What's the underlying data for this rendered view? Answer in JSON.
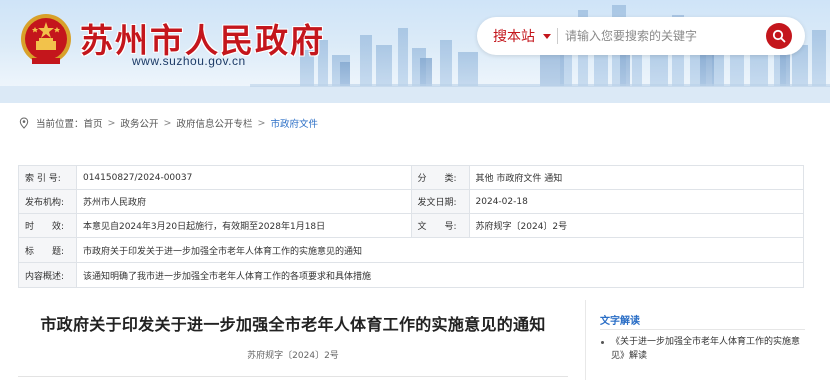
{
  "header": {
    "site_title": "苏州市人民政府",
    "site_url": "www.suzhou.gov.cn",
    "search": {
      "scope_label": "搜本站",
      "placeholder": "请输入您要搜索的关键字"
    }
  },
  "breadcrumb": {
    "prefix": "当前位置：",
    "items": [
      "首页",
      "政务公开",
      "政府信息公开专栏",
      "市政府文件"
    ],
    "separator": ">"
  },
  "info": {
    "index_label": "索 引 号:",
    "index_value": "014150827/2024-00037",
    "category_label": "分　　类:",
    "category_value": "其他 市政府文件 通知",
    "issuer_label": "发布机构:",
    "issuer_value": "苏州市人民政府",
    "date_label": "发文日期:",
    "date_value": "2024-02-18",
    "validity_label": "时　　效:",
    "validity_value": "本意见自2024年3月20日起施行，有效期至2028年1月18日",
    "docno_label": "文　　号:",
    "docno_value": "苏府规字〔2024〕2号",
    "title_label": "标　　题:",
    "title_value": "市政府关于印发关于进一步加强全市老年人体育工作的实施意见的通知",
    "summary_label": "内容概述:",
    "summary_value": "该通知明确了我市进一步加强全市老年人体育工作的各项要求和具体措施"
  },
  "article": {
    "title": "市政府关于印发关于进一步加强全市老年人体育工作的实施意见的通知",
    "doc_number": "苏府规字〔2024〕2号"
  },
  "side": {
    "title": "文字解读",
    "items": [
      "《关于进一步加强全市老年人体育工作的实施意见》解读"
    ]
  },
  "colors": {
    "brand_red": "#c4161c",
    "link_blue": "#2a6ec6",
    "banner_sky": "#cfe4f8"
  }
}
